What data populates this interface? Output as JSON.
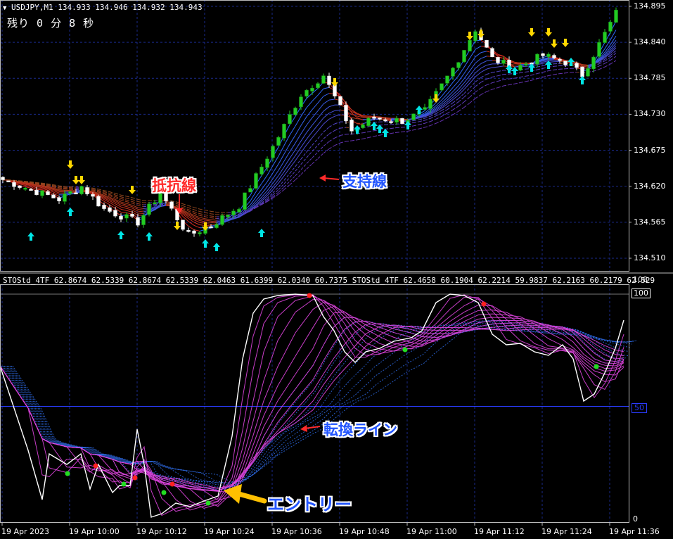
{
  "window": {
    "symbol_line": "USDJPY,M1  134.933 134.946 134.932 134.943",
    "countdown": "残り 0 分 8 秒"
  },
  "price_axis": {
    "ticks": [
      "134.895",
      "134.840",
      "134.785",
      "134.730",
      "134.675",
      "134.620",
      "134.565",
      "134.510"
    ]
  },
  "indicator": {
    "header": "STOStd_4TF 62.8674 62.5339 62.8674 62.5339 62.0463 61.6399 62.0340 60.7375  STOStd_4TF 62.4658 60.1904 62.2214 59.9837 62.2163 60.2179 62.529",
    "axis_top": "108",
    "level_100": "100",
    "level_50": "50",
    "axis_zero": "0"
  },
  "time_axis": {
    "labels": [
      "19 Apr 2023",
      "19 Apr 10:00",
      "19 Apr 10:12",
      "19 Apr 10:24",
      "19 Apr 10:36",
      "19 Apr 10:48",
      "19 Apr 11:00",
      "19 Apr 11:12",
      "19 Apr 11:24",
      "19 Apr 11:36"
    ]
  },
  "annotations": {
    "resistance": "抵抗線",
    "support": "支持線",
    "turning_line": "転換ライン",
    "entry": "エントリー"
  },
  "colors": {
    "background": "#000000",
    "grid": "#1a2a8a",
    "bull_candle": "#22cc22",
    "bear_candle": "#ffffff",
    "up_arrow": "#00e5e5",
    "down_arrow": "#ffd700",
    "resistance_text": "#ff2a2a",
    "support_text": "#2255ff",
    "stoch_main": "#ffffff",
    "stoch_ribbon": "#dd44dd",
    "stoch_blue": "#3377ff",
    "entry_arrow": "#ffc000"
  }
}
